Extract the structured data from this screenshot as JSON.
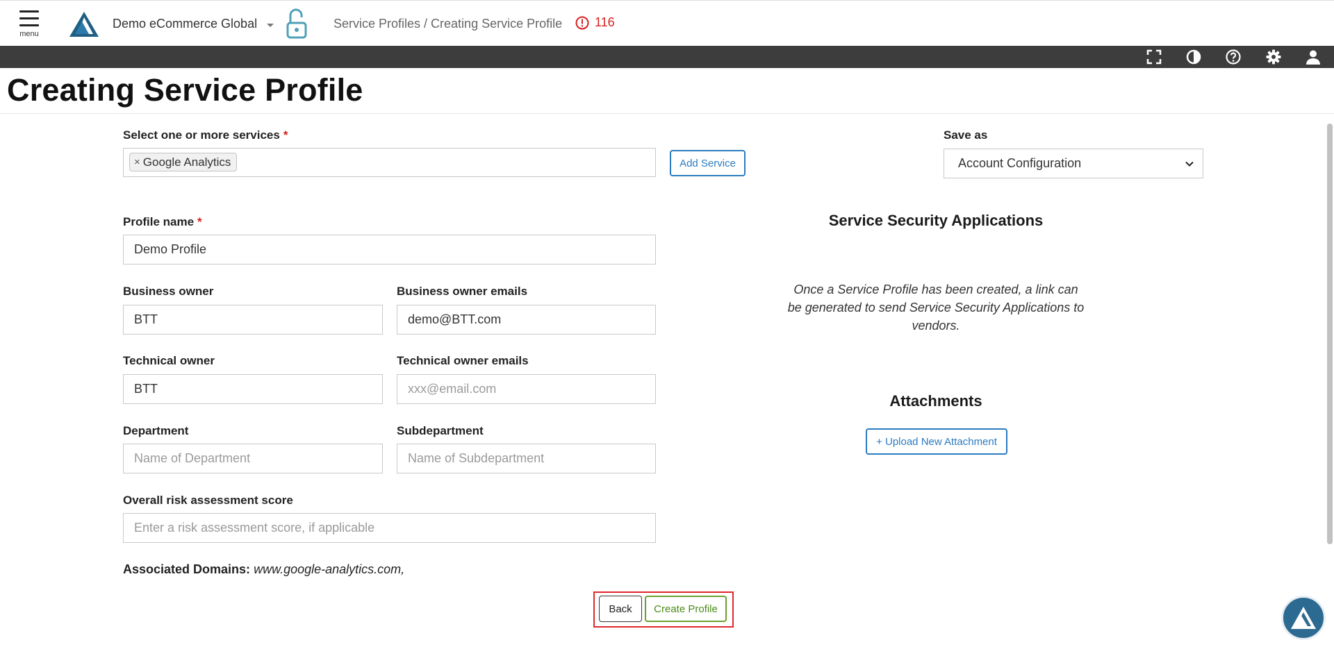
{
  "header": {
    "menu_label": "menu",
    "org_name": "Demo eCommerce Global",
    "breadcrumb": "Service Profiles / Creating Service Profile",
    "alert_count": "116"
  },
  "toolbar": {
    "icons": [
      "fullscreen-icon",
      "contrast-icon",
      "help-icon",
      "settings-icon",
      "user-icon"
    ]
  },
  "page": {
    "title": "Creating Service Profile"
  },
  "form": {
    "services_label": "Select one or more services",
    "required_mark": "*",
    "selected_services": [
      "Google Analytics"
    ],
    "tag_remove": "×",
    "add_service_label": "Add Service",
    "save_as_label": "Save as",
    "save_as_value": "Account Configuration",
    "profile_name_label": "Profile name",
    "profile_name_value": "Demo Profile",
    "business_owner_label": "Business owner",
    "business_owner_value": "BTT",
    "business_owner_emails_label": "Business owner emails",
    "business_owner_emails_value": "demo@BTT.com",
    "technical_owner_label": "Technical owner",
    "technical_owner_value": "BTT",
    "technical_owner_emails_label": "Technical owner emails",
    "technical_owner_emails_placeholder": "xxx@email.com",
    "department_label": "Department",
    "department_placeholder": "Name of Department",
    "subdepartment_label": "Subdepartment",
    "subdepartment_placeholder": "Name of Subdepartment",
    "risk_label": "Overall risk assessment score",
    "risk_placeholder": "Enter a risk assessment score, if applicable",
    "domains_label": "Associated Domains:",
    "domains_value": "www.google-analytics.com,"
  },
  "side": {
    "ssa_title": "Service Security Applications",
    "ssa_text": "Once a Service Profile has been created, a link can be generated to send Service Security Applications to vendors.",
    "attachments_title": "Attachments",
    "upload_label": "+ Upload New Attachment"
  },
  "actions": {
    "back_label": "Back",
    "create_label": "Create Profile"
  },
  "colors": {
    "accent_blue": "#2a7bc0",
    "toolbar_bg": "#3d3d3d",
    "alert_red": "#d61f1f",
    "create_green": "#6aa12d",
    "highlight_red": "#e0262a",
    "brand_teal": "#2d6a91"
  }
}
